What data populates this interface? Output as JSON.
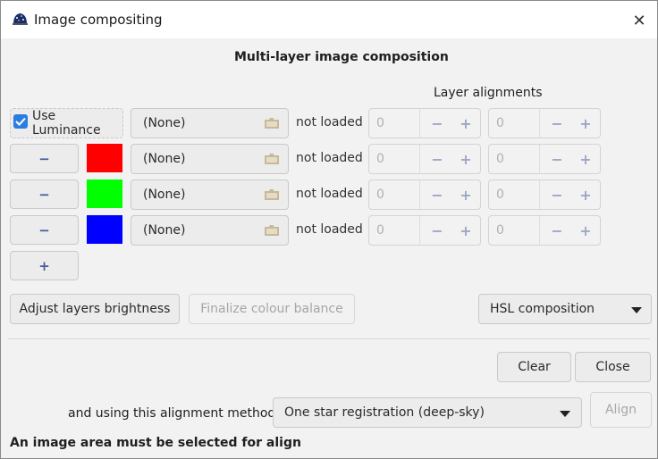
{
  "window": {
    "title": "Image compositing",
    "close_glyph": "✕"
  },
  "heading": "Multi-layer image composition",
  "alignments_label": "Layer alignments",
  "luminance": {
    "label": "Use Luminance",
    "checked": true
  },
  "remove_glyph": "−",
  "add_glyph": "+",
  "rows": [
    {
      "file": "(None)",
      "status": "not loaded",
      "x": "0",
      "y": "0"
    },
    {
      "file": "(None)",
      "status": "not loaded",
      "x": "0",
      "y": "0",
      "color": "#ff0000"
    },
    {
      "file": "(None)",
      "status": "not loaded",
      "x": "0",
      "y": "0",
      "color": "#00ff00"
    },
    {
      "file": "(None)",
      "status": "not loaded",
      "x": "0",
      "y": "0",
      "color": "#0000ff"
    }
  ],
  "buttons": {
    "adjust": "Adjust layers brightness",
    "finalize": "Finalize colour balance",
    "clear": "Clear",
    "close": "Close",
    "align": "Align"
  },
  "composition_mode": "HSL composition",
  "alignment": {
    "label": "and using this alignment method:",
    "method": "One star registration (deep-sky)"
  },
  "status_message": "An image area must be selected for align"
}
